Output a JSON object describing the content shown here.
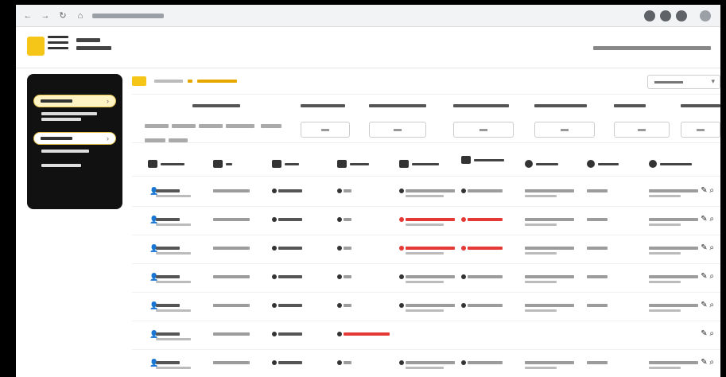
{
  "icons": {
    "back": "left-arrow-icon",
    "forward": "right-arrow-icon",
    "reload": "reload-icon",
    "home": "home-icon",
    "edit": "pencil-icon",
    "view": "magnifier-icon",
    "person": "person-icon"
  },
  "colors": {
    "accent": "#f5c518",
    "sidebar_bg": "#111111",
    "alert_red": "#e53935"
  },
  "status_rows": [
    {
      "status_red": false
    },
    {
      "status_red": true
    },
    {
      "status_red": true
    },
    {
      "status_red": false
    },
    {
      "status_red": false
    },
    {
      "status_red": false,
      "partial": true
    },
    {
      "status_red": false
    }
  ]
}
